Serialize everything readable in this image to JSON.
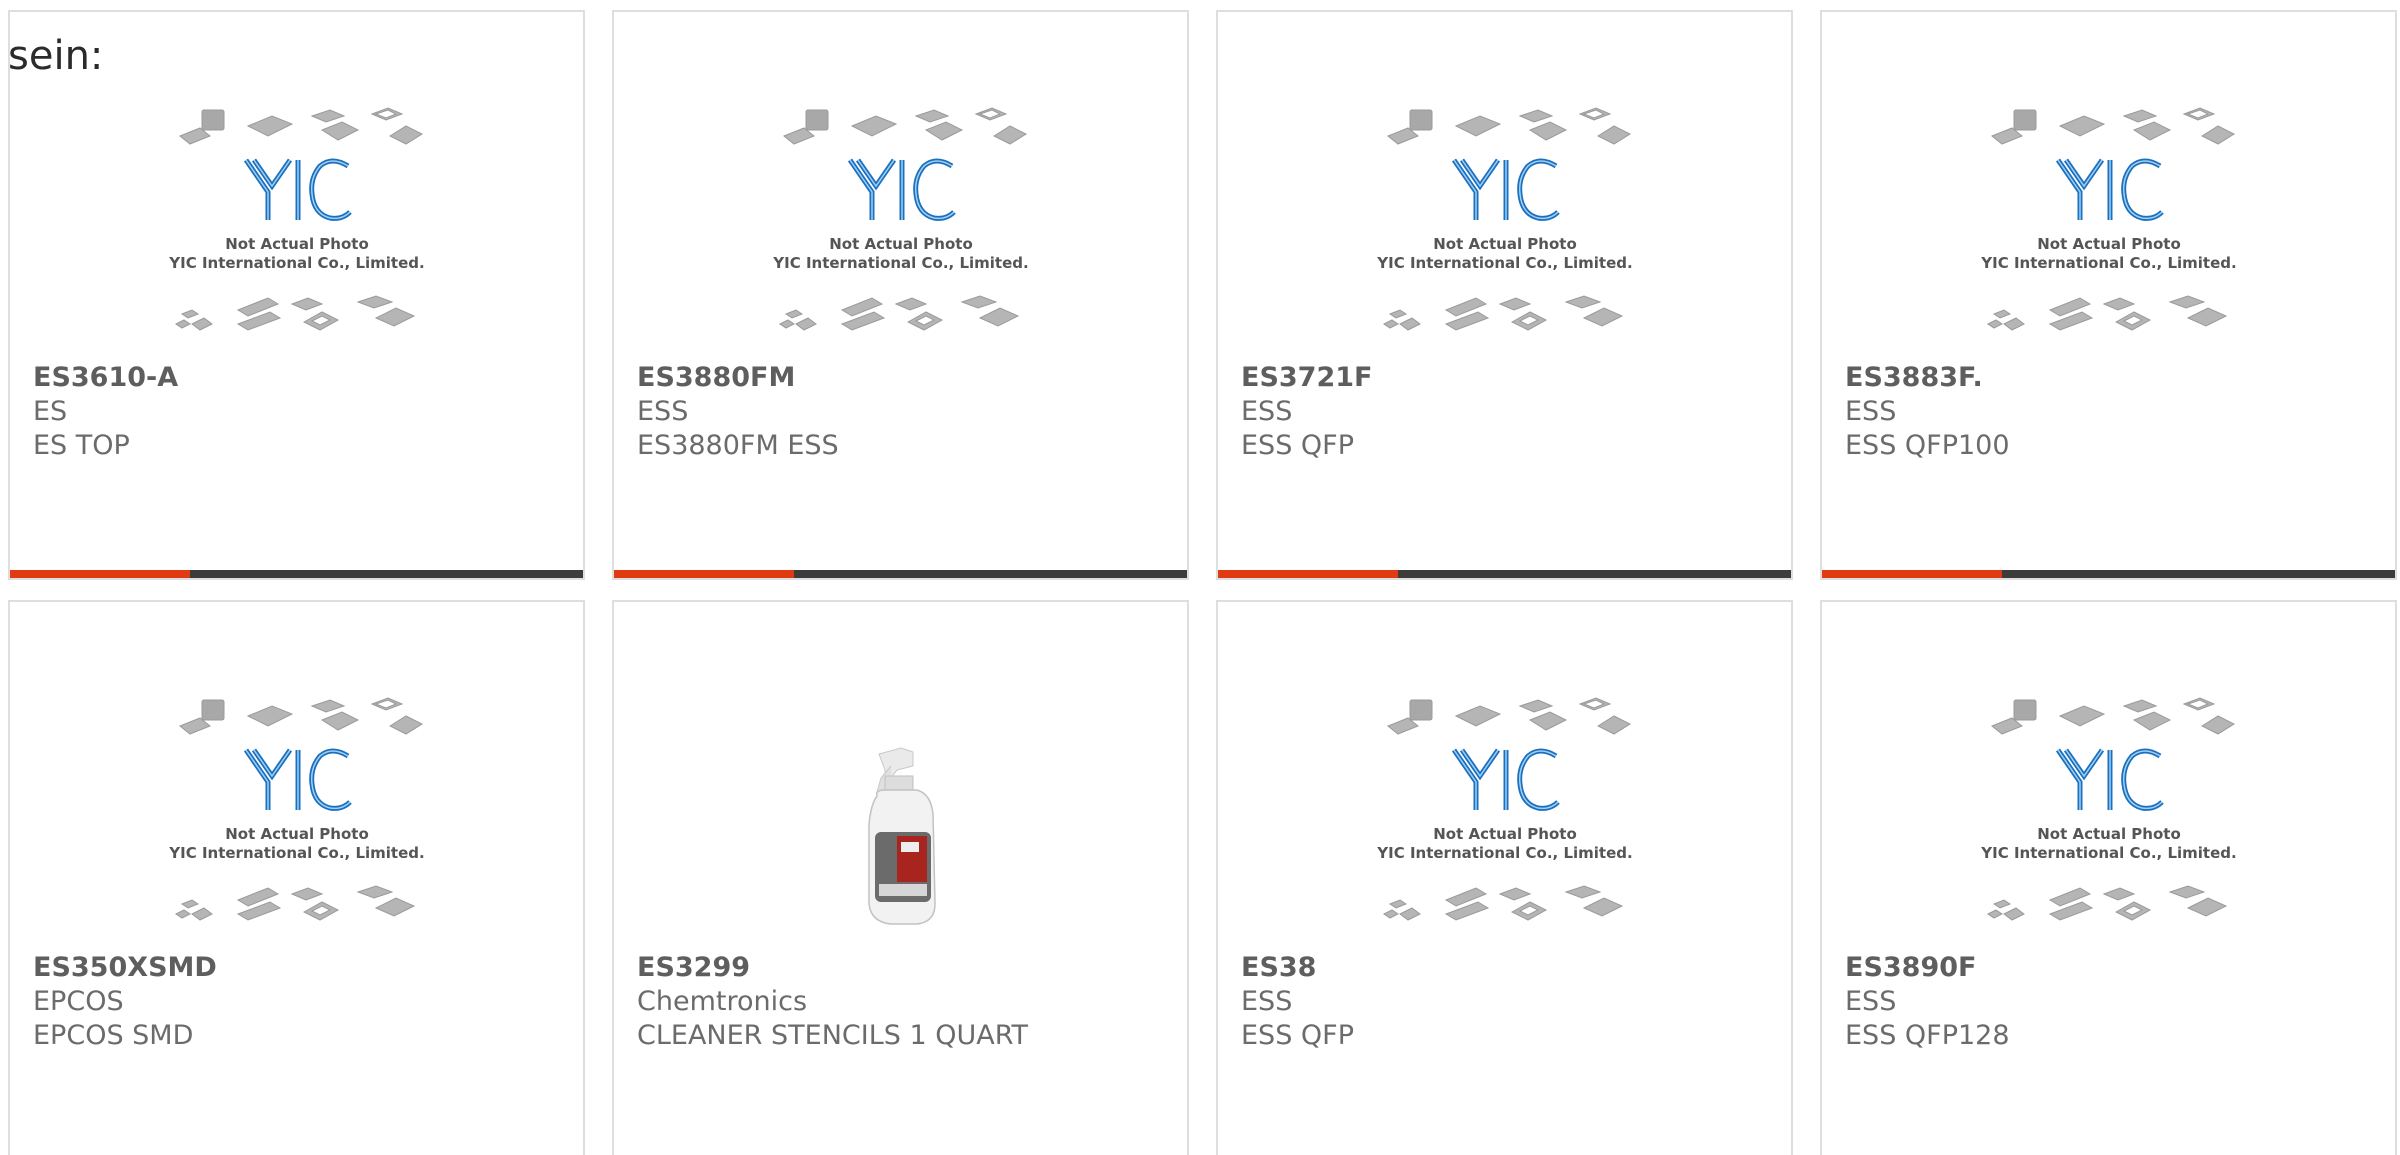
{
  "intro_text": "sein:",
  "placeholder_photo": {
    "logo": "YIC",
    "line1": "Not Actual Photo",
    "line2": "YIC International Co., Limited."
  },
  "accent_color": "#e03a12",
  "bar_color": "#3c3c3c",
  "products": [
    {
      "part": "ES3610-A",
      "maker": "ES",
      "desc": "ES TOP",
      "image": "yic-placeholder",
      "bar": true
    },
    {
      "part": "ES3880FM",
      "maker": "ESS",
      "desc": "ES3880FM ESS",
      "image": "yic-placeholder",
      "bar": true
    },
    {
      "part": "ES3721F",
      "maker": "ESS",
      "desc": "ESS QFP",
      "image": "yic-placeholder",
      "bar": true
    },
    {
      "part": "ES3883F.",
      "maker": "ESS",
      "desc": "ESS QFP100",
      "image": "yic-placeholder",
      "bar": true
    },
    {
      "part": "ES350XSMD",
      "maker": "EPCOS",
      "desc": "EPCOS SMD",
      "image": "yic-placeholder",
      "bar": false
    },
    {
      "part": "ES3299",
      "maker": "Chemtronics",
      "desc": "CLEANER STENCILS 1 QUART",
      "image": "spray-bottle",
      "bar": false
    },
    {
      "part": "ES38",
      "maker": "ESS",
      "desc": "ESS QFP",
      "image": "yic-placeholder",
      "bar": false
    },
    {
      "part": "ES3890F",
      "maker": "ESS",
      "desc": "ESS QFP128",
      "image": "yic-placeholder",
      "bar": false
    }
  ]
}
